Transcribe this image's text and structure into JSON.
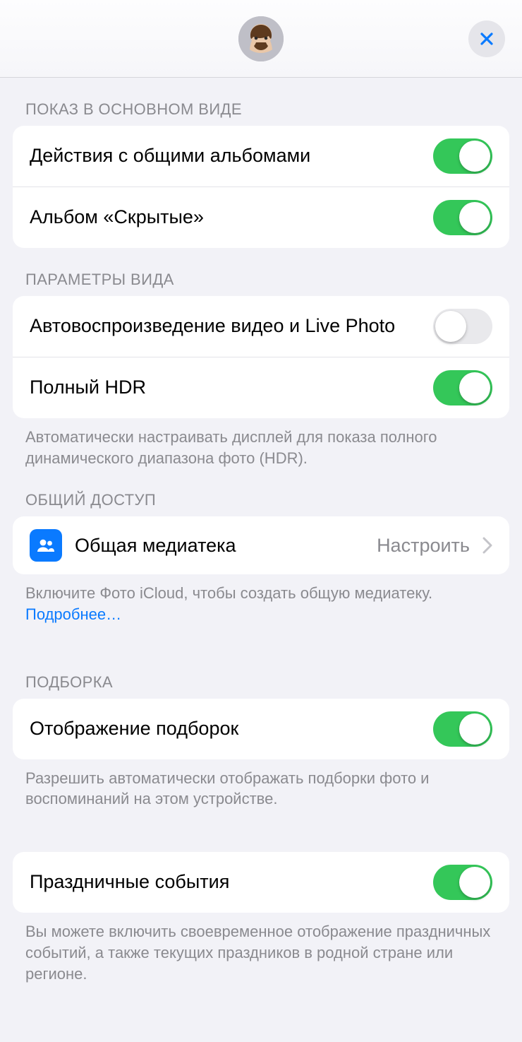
{
  "colors": {
    "accent": "#0a7aff",
    "toggle_on": "#34c759"
  },
  "sections": {
    "main_view": {
      "header": "ПОКАЗ В ОСНОВНОМ ВИДЕ",
      "rows": {
        "shared_albums": {
          "label": "Действия с общими альбомами",
          "on": true
        },
        "hidden_album": {
          "label": "Альбом «Скрытые»",
          "on": true
        }
      }
    },
    "view_params": {
      "header": "ПАРАМЕТРЫ ВИДА",
      "rows": {
        "autoplay": {
          "label": "Автовоспроизведение видео и Live Photo",
          "on": false
        },
        "hdr": {
          "label": "Полный HDR",
          "on": true
        }
      },
      "footer": "Автоматически настраивать дисплей для показа полного динамического диапазона фото (HDR)."
    },
    "sharing": {
      "header": "ОБЩИЙ ДОСТУП",
      "rows": {
        "shared_library": {
          "icon": "people-icon",
          "label": "Общая медиатека",
          "value": "Настроить"
        }
      },
      "footer_text": "Включите Фото iCloud, чтобы создать общую медиатеку. ",
      "footer_link": "Подробнее…"
    },
    "featured": {
      "header": "ПОДБОРКА",
      "rows": {
        "show_featured": {
          "label": "Отображение подборок",
          "on": true
        }
      },
      "footer": "Разрешить автоматически отображать подборки фото и воспоминаний на этом устройстве."
    },
    "holidays": {
      "rows": {
        "holiday_events": {
          "label": "Праздничные события",
          "on": true
        }
      },
      "footer": "Вы можете включить своевременное отображение праздничных событий, а также текущих праздников в родной стране или регионе."
    }
  }
}
